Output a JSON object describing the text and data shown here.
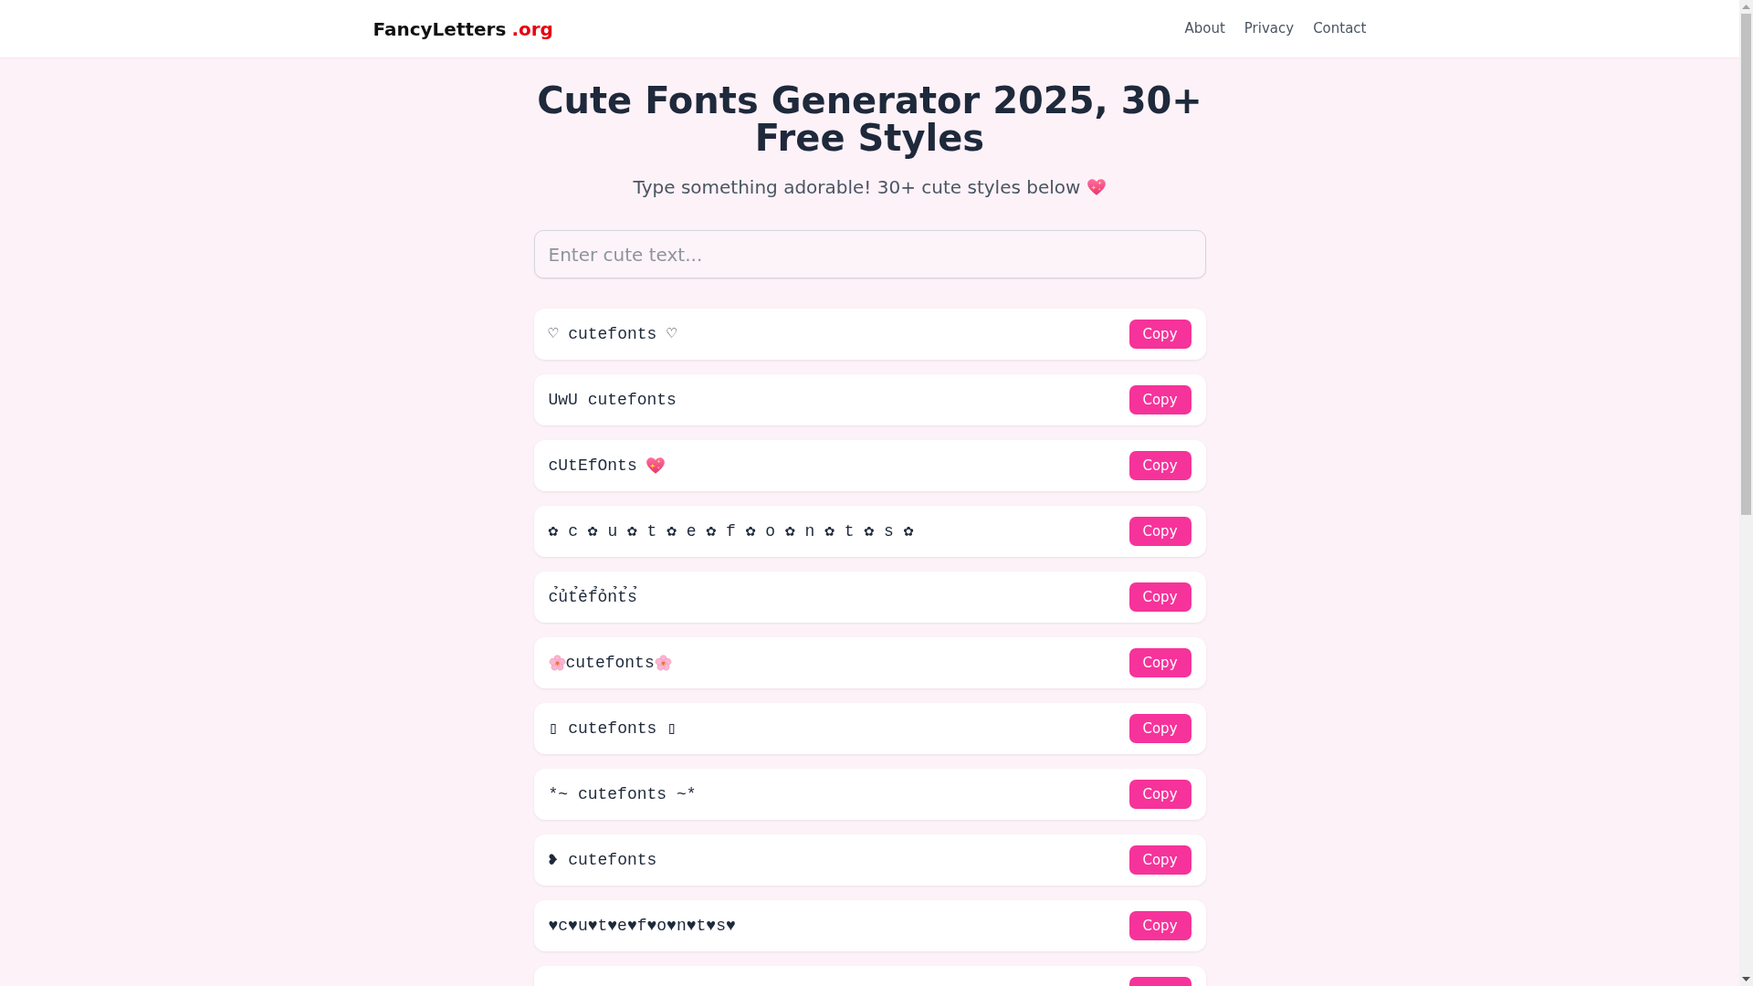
{
  "navbar": {
    "brand": {
      "name": "FancyLetters",
      "suffix": ".org"
    },
    "links": [
      "About",
      "Privacy",
      "Contact"
    ]
  },
  "header": {
    "title": "Cute Fonts Generator 2025, 30+ Free Styles",
    "subtitle": "Type something adorable! 30+ cute styles below"
  },
  "input": {
    "placeholder": "Enter cute text..."
  },
  "styles": [
    {
      "kind": "plain",
      "text": "♡ cutefonts ♡",
      "button": "Copy"
    },
    {
      "kind": "plain",
      "text": "UwU cutefonts",
      "button": "Copy"
    },
    {
      "kind": "sparkleheart",
      "text": "cUtEfOnts",
      "button": "Copy"
    },
    {
      "kind": "plain",
      "text": "✿ c ✿ u ✿ t ✿ e ✿ f ✿ o ✿ n ✿ t ✿ s ✿",
      "button": "Copy"
    },
    {
      "kind": "plain",
      "text": "c̉ủt̉ẻf̉ỏn̉t̉s̉",
      "button": "Copy"
    },
    {
      "kind": "blossom",
      "text": "cutefonts",
      "button": "Copy"
    },
    {
      "kind": "plain",
      "text": "▯ cutefonts ▯",
      "button": "Copy"
    },
    {
      "kind": "plain",
      "text": "*~ cutefonts ~*",
      "button": "Copy"
    },
    {
      "kind": "plain",
      "text": "❥ cutefonts",
      "button": "Copy"
    },
    {
      "kind": "plain",
      "text": "♥c♥u♥t♥e♥f♥o♥n♥t♥s♥",
      "button": "Copy"
    },
    {
      "kind": "plain"
    }
  ]
}
